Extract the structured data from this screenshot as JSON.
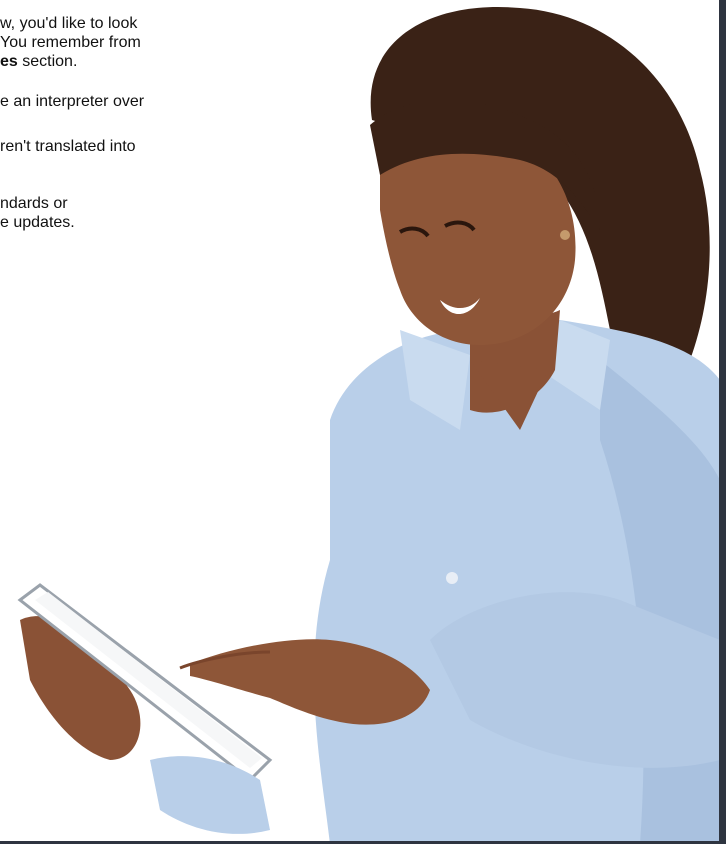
{
  "slide": {
    "intro": {
      "line1": "w, you'd like to look",
      "line2": "You remember from",
      "line3_bold": "es",
      "line3_rest": " section."
    },
    "items": [
      {
        "lines": [
          "e an interpreter over"
        ]
      },
      {
        "lines": [
          "ren't translated into"
        ]
      },
      {
        "lines": [
          "ndards or",
          "e updates."
        ]
      }
    ],
    "photo": {
      "subject": "woman-smiling-with-tablet",
      "shirt_color": "#b9cfe9",
      "hair_color": "#3a2216",
      "skin_color": "#8a5236"
    },
    "colors": {
      "frame": "#2e3440",
      "background": "#ffffff",
      "text": "#111111"
    }
  }
}
